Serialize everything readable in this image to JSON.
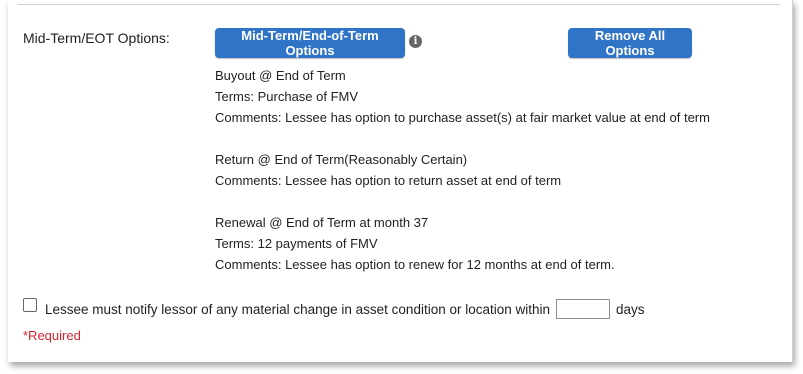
{
  "section": {
    "label": "Mid-Term/EOT Options:"
  },
  "buttons": {
    "options_label": "Mid-Term/End-of-Term Options",
    "remove_label": "Remove All Options"
  },
  "info_icon_glyph": "i",
  "options": [
    {
      "lines": [
        "Buyout @ End of Term",
        "Terms: Purchase of FMV",
        "Comments: Lessee has option to purchase asset(s) at fair market value at end of term"
      ]
    },
    {
      "lines": [
        "Return @ End of Term(Reasonably Certain)",
        "Comments: Lessee has option to return asset at end of term"
      ]
    },
    {
      "lines": [
        "Renewal @ End of Term at month 37",
        "Terms: 12 payments of FMV",
        "Comments: Lessee has option to renew for 12 months at end of term."
      ]
    }
  ],
  "notify": {
    "text": "Lessee must notify lessor of any material change in asset condition or location within",
    "days_value": "",
    "suffix": "days",
    "checked": false
  },
  "required_text": "*Required",
  "colors": {
    "button_bg": "#2f74c6",
    "required": "#d9232e"
  }
}
